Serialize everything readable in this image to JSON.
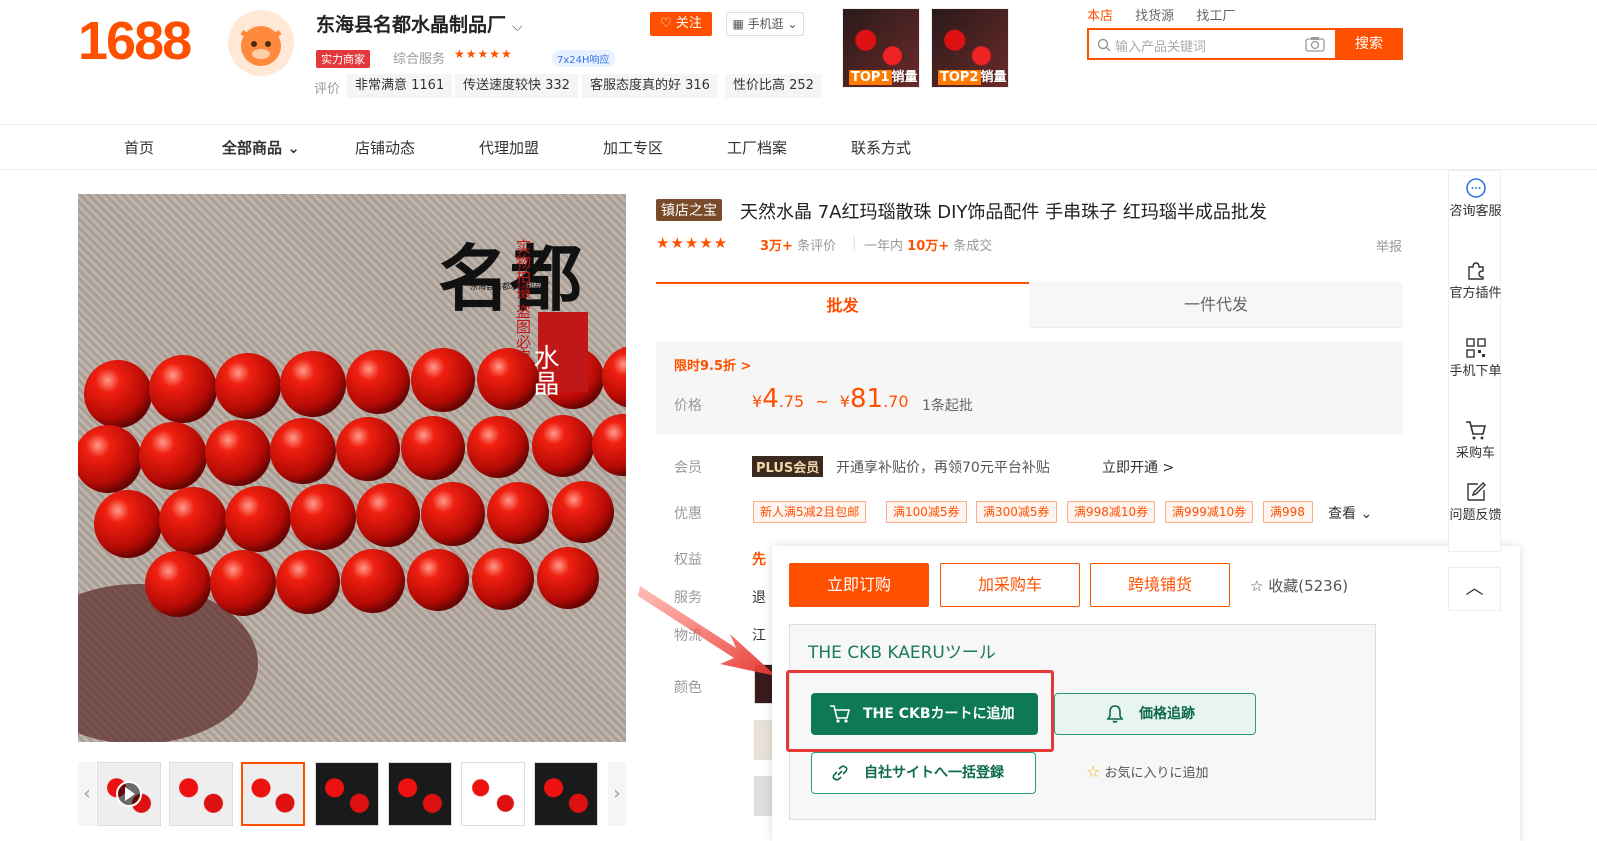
{
  "header": {
    "logo": "1688",
    "shop_name": "东海县名都水晶制品厂",
    "follow": "关注",
    "mobile": "手机逛",
    "badge": "实力商家",
    "service_label": "综合服务",
    "service_stars": "★★★★★",
    "response": "7x24H响应",
    "rating_label": "评价",
    "ratings": [
      "非常满意 1161",
      "传送速度较快 332",
      "客服态度真的好 316",
      "性价比高 252"
    ],
    "top_items": [
      {
        "rank": "TOP1",
        "text": "销量"
      },
      {
        "rank": "TOP2",
        "text": "销量"
      }
    ],
    "search_tabs": [
      "本店",
      "找货源",
      "找工厂"
    ],
    "search_placeholder": "输入产品关键词",
    "search_button": "搜索"
  },
  "nav": [
    "首页",
    "全部商品",
    "店铺动态",
    "代理加盟",
    "加工专区",
    "工厂档案",
    "联系方式"
  ],
  "product": {
    "badge": "镇店之宝",
    "title": "天然水晶 7A红玛瑙散珠 DIY饰品配件 手串珠子 红玛瑙半成品批发",
    "stars": "★★★★★",
    "reviews_count": "3万+",
    "reviews_suffix": "条评价",
    "sold_prefix": "一年内",
    "sold_count": "10万+",
    "sold_suffix": "条成交",
    "report": "举报",
    "tab_wholesale": "批发",
    "tab_dropship": "一件代发",
    "flash": "限时9.5折 >",
    "price_label": "价格",
    "price_low_int": "4",
    "price_low_dec": ".75",
    "price_high_int": "81",
    "price_high_dec": ".70",
    "price_sep": "~",
    "currency": "¥",
    "moq": "1条起批",
    "member_label": "会员",
    "plus_badge": "PLUS会员",
    "plus_text": "开通享补贴价，再领70元平台补贴",
    "open_now": "立即开通 >",
    "discount_label": "优惠",
    "coupons": [
      "新人满5减2且包邮",
      "满100减5券",
      "满300减5券",
      "满998减10券",
      "满999减10券",
      "满998"
    ],
    "more": "查看 ⌄",
    "rights_label": "权益",
    "rights_value": "先",
    "service_label": "服务",
    "service_value": "退",
    "logistics_label": "物流",
    "logistics_value": "江",
    "color_label": "颜色"
  },
  "image_text": {
    "brand": "名都",
    "tag": "水晶",
    "slogan": "实物拍摄 盗图必究",
    "sub": "东海县名都水晶制品厂"
  },
  "actions": {
    "order": "立即订购",
    "add_cart": "加采购车",
    "cross_border": "跨境铺货",
    "favorite": "收藏(5236)"
  },
  "ckb": {
    "title": "THE CKB KAERUツール",
    "add": "THE CKBカートに追加",
    "price_track": "価格追跡",
    "register": "自社サイトへ一括登録",
    "fav": "お気に入りに追加"
  },
  "sidebar": [
    {
      "label": "咨询客服",
      "icon": "chat-icon"
    },
    {
      "label": "官方插件",
      "icon": "puzzle-icon"
    },
    {
      "label": "手机下单",
      "icon": "qrcode-icon"
    },
    {
      "label": "采购车",
      "icon": "cart-icon"
    },
    {
      "label": "问题反馈",
      "icon": "edit-icon"
    }
  ],
  "colors": {
    "brand": "#ff5000",
    "ckb_green": "#0e7a55",
    "highlight": "#e53935"
  }
}
